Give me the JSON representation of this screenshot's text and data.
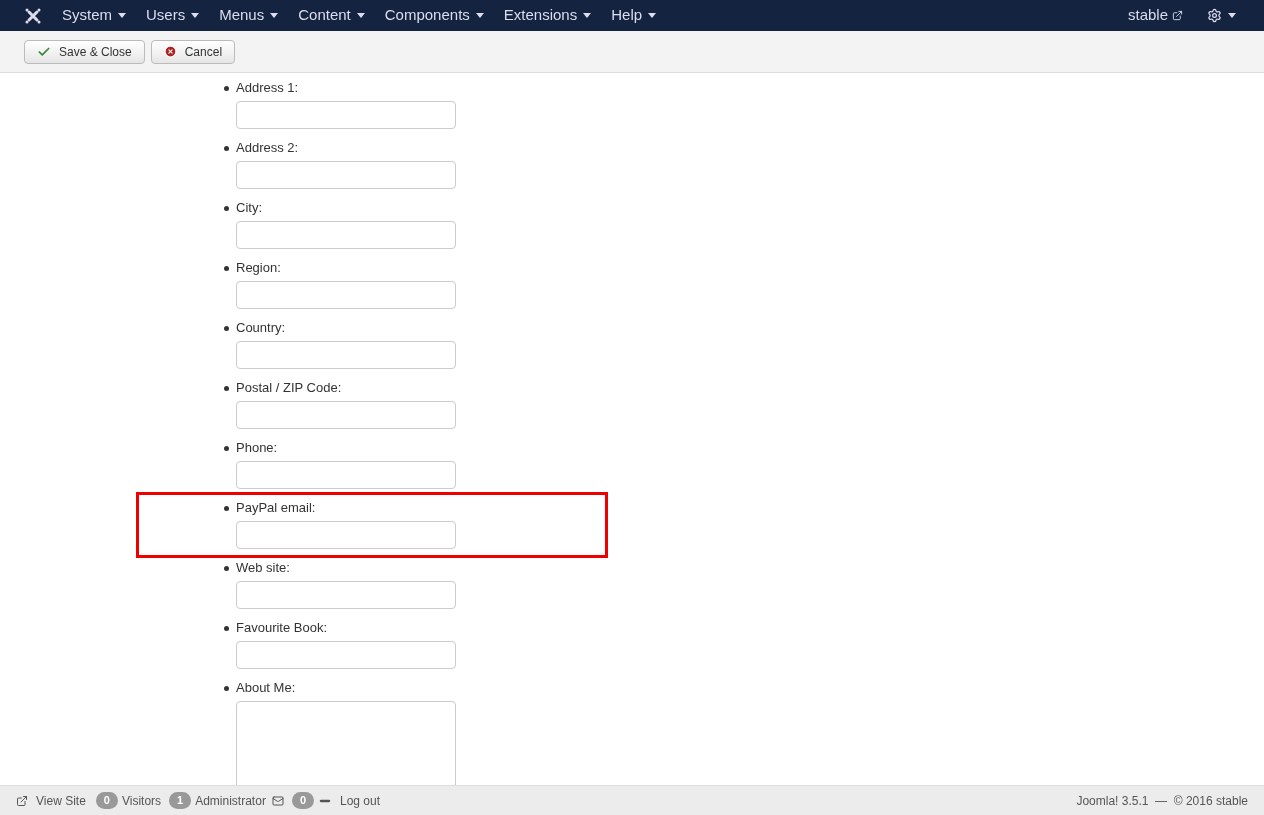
{
  "menu": [
    {
      "label": "System"
    },
    {
      "label": "Users"
    },
    {
      "label": "Menus"
    },
    {
      "label": "Content"
    },
    {
      "label": "Components"
    },
    {
      "label": "Extensions"
    },
    {
      "label": "Help"
    }
  ],
  "site_link": "stable",
  "toolbar": [
    {
      "label": "Save & Close",
      "kind": "save"
    },
    {
      "label": "Cancel",
      "kind": "cancel"
    }
  ],
  "fields": [
    {
      "label": "Address 1:",
      "kind": "input",
      "highlighted": false
    },
    {
      "label": "Address 2:",
      "kind": "input",
      "highlighted": false
    },
    {
      "label": "City:",
      "kind": "input",
      "highlighted": false
    },
    {
      "label": "Region:",
      "kind": "input",
      "highlighted": false
    },
    {
      "label": "Country:",
      "kind": "input",
      "highlighted": false
    },
    {
      "label": "Postal / ZIP Code:",
      "kind": "input",
      "highlighted": false
    },
    {
      "label": "Phone:",
      "kind": "input",
      "highlighted": false
    },
    {
      "label": "PayPal email:",
      "kind": "input",
      "highlighted": true
    },
    {
      "label": "Web site:",
      "kind": "input",
      "highlighted": false
    },
    {
      "label": "Favourite Book:",
      "kind": "input",
      "highlighted": false
    },
    {
      "label": "About Me:",
      "kind": "textarea",
      "highlighted": false
    }
  ],
  "status_bar": {
    "view_site": "View Site",
    "visitors_count": "0",
    "visitors": "Visitors",
    "admins_count": "1",
    "admins": "Administrator",
    "messages_count": "0",
    "logout": "Log out",
    "version": "Joomla! 3.5.1  —  © 2016 stable"
  }
}
